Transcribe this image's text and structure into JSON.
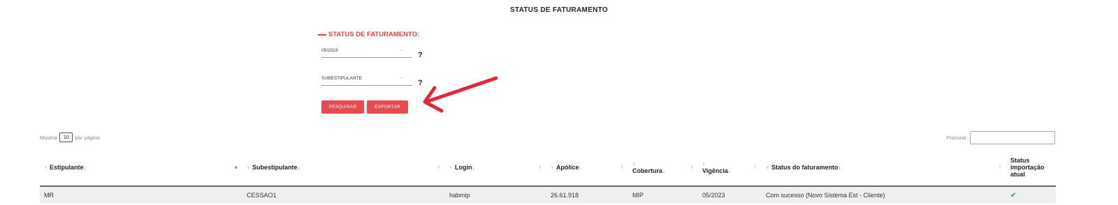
{
  "page": {
    "title": "STATUS DE FATURAMENTO"
  },
  "filters": {
    "section_title": "STATUS DE FATURAMENTO:",
    "period_select": "05/2023",
    "type_select": "SUBESTIPULANTE",
    "help_symbol": "?",
    "caret_symbol": "-"
  },
  "buttons": {
    "search": "PESQUISAR",
    "export": "EXPORTAR"
  },
  "table_controls": {
    "length_prefix": "Mostrar",
    "length_value": "10",
    "length_suffix": "por página",
    "search_label": "Procurar:"
  },
  "table": {
    "headers": [
      {
        "label": "Estipulante",
        "indicator": "▲"
      },
      {
        "label": "Subestipulante",
        "indicator": "⇕"
      },
      {
        "label": "Login",
        "indicator": "⇕"
      },
      {
        "label": "Apólice",
        "indicator": "⇕"
      },
      {
        "label": "Cobertura",
        "indicator": "⇕"
      },
      {
        "label": "Vigência",
        "indicator": "⇕"
      },
      {
        "label": "Status do faturamento",
        "indicator": "⇕"
      },
      {
        "label": "Status importação atual",
        "indicator": ""
      }
    ],
    "rows": [
      {
        "estipulante": "MR",
        "subestipulante": "CESSAO1",
        "login": "habmip",
        "apolice": "26.61.918",
        "cobertura": "MIP",
        "vigencia": "05/2023",
        "status_faturamento": "Com sucesso (Novo Sistema Est - Cliente)",
        "status_importacao_icon": "check-icon"
      }
    ]
  },
  "colors": {
    "accent": "#e0413f",
    "button": "#e64b50",
    "arrow": "#e0283a",
    "success": "#2e9b2e"
  }
}
